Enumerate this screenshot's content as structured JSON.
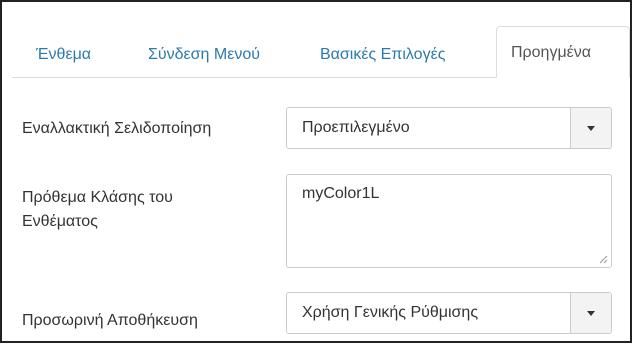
{
  "tabs": [
    {
      "label": "Ένθεμα",
      "active": false
    },
    {
      "label": "Σύνδεση Μενού",
      "active": false
    },
    {
      "label": "Βασικές Επιλογές",
      "active": false
    },
    {
      "label": "Προηγμένα",
      "active": true
    }
  ],
  "fields": {
    "alt_layout": {
      "label": "Εναλλακτική Σελιδοποίηση",
      "value": "Προεπιλεγμένο"
    },
    "module_class": {
      "label": "Πρόθεμα Κλάσης του Ενθέματος",
      "value": "myColor1L"
    },
    "caching": {
      "label": "Προσωρινή Αποθήκευση",
      "value": "Χρήση Γενικής Ρύθμισης"
    }
  },
  "colors": {
    "link": "#2a7ab0",
    "border": "#cccccc",
    "tab_border": "#dddddd"
  },
  "icons": [
    "chevron-down-icon",
    "resize-grip-icon"
  ]
}
